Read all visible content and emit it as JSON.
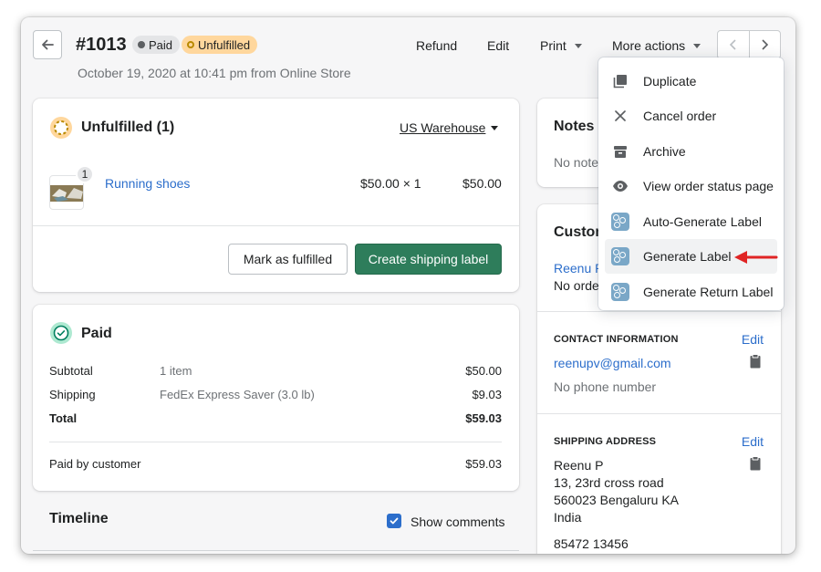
{
  "header": {
    "order_number": "#1013",
    "badges": {
      "paid": "Paid",
      "unfulfilled": "Unfulfilled"
    },
    "subtitle": "October 19, 2020 at 10:41 pm from Online Store",
    "actions": {
      "refund": "Refund",
      "edit": "Edit",
      "print": "Print",
      "more": "More actions"
    }
  },
  "fulfillment": {
    "title": "Unfulfilled (1)",
    "location": "US Warehouse",
    "item": {
      "name": "Running shoes",
      "qty_badge": "1",
      "price_qty": "$50.00 × 1",
      "total": "$50.00"
    },
    "buttons": {
      "mark": "Mark as fulfilled",
      "create": "Create shipping label"
    }
  },
  "payment": {
    "title": "Paid",
    "rows": [
      {
        "label": "Subtotal",
        "detail": "1 item",
        "amount": "$50.00"
      },
      {
        "label": "Shipping",
        "detail": "FedEx Express Saver (3.0 lb)",
        "amount": "$9.03"
      },
      {
        "label": "Total",
        "detail": "",
        "amount": "$59.03"
      }
    ],
    "paid_by": {
      "label": "Paid by customer",
      "amount": "$59.03"
    }
  },
  "timeline": {
    "title": "Timeline",
    "show_comments": "Show comments"
  },
  "notes": {
    "title": "Notes",
    "text": "No note"
  },
  "customer": {
    "title": "Custom",
    "name": "Reenu P",
    "orders": "No orde",
    "contact_heading": "CONTACT INFORMATION",
    "contact_edit": "Edit",
    "email": "reenupv@gmail.com",
    "phone": "No phone number",
    "shipping_heading": "SHIPPING ADDRESS",
    "shipping_edit": "Edit",
    "address": [
      "Reenu P",
      "13, 23rd cross road",
      "560023 Bengaluru KA",
      "India"
    ],
    "address_phone": "85472 13456"
  },
  "more_menu": {
    "items": [
      {
        "label": "Duplicate",
        "icon": "duplicate-icon"
      },
      {
        "label": "Cancel order",
        "icon": "close-icon"
      },
      {
        "label": "Archive",
        "icon": "archive-icon"
      },
      {
        "label": "View order status page",
        "icon": "eye-icon"
      },
      {
        "label": "Auto-Generate Label",
        "icon": "app-logo-icon"
      },
      {
        "label": "Generate Label",
        "icon": "app-logo-icon"
      },
      {
        "label": "Generate Return Label",
        "icon": "app-logo-icon"
      }
    ]
  },
  "colors": {
    "primary": "#2e7d5b",
    "link": "#2c6ecb",
    "annotation_arrow": "#e02424",
    "badge_unfulfilled": "#ffd79d"
  }
}
